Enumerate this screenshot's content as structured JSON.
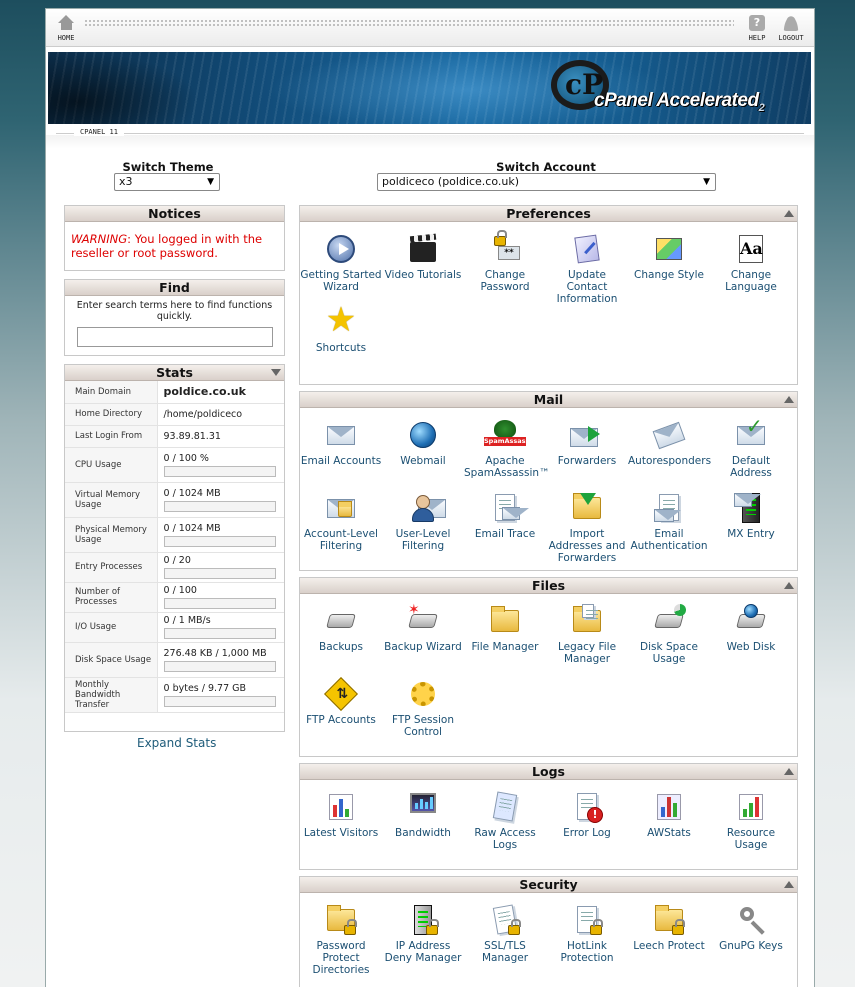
{
  "topbar": {
    "home": "HOME",
    "help": "HELP",
    "logout": "LOGOUT",
    "help_glyph": "?"
  },
  "banner": {
    "logo_mark": "cP",
    "logo_text": "cPanel Accelerated",
    "logo_sub": "2"
  },
  "subbar": {
    "label": "CPANEL 11"
  },
  "switch_theme": {
    "label": "Switch Theme",
    "value": "x3"
  },
  "switch_account": {
    "label": "Switch Account",
    "value": "poldiceco (poldice.co.uk)"
  },
  "notices": {
    "title": "Notices",
    "warning_prefix": "WARNING",
    "warning_text": ": You logged in with the reseller or root password."
  },
  "find": {
    "title": "Find",
    "hint": "Enter search terms here to find functions quickly.",
    "value": ""
  },
  "stats": {
    "title": "Stats",
    "rows": [
      {
        "label": "Main Domain",
        "value": "poldice.co.uk",
        "bold": true
      },
      {
        "label": "Home Directory",
        "value": "/home/poldiceco"
      },
      {
        "label": "Last Login From",
        "value": "93.89.81.31"
      },
      {
        "label": "CPU Usage",
        "value": "0 / 100 %",
        "bar": 0
      },
      {
        "label": "Virtual Memory Usage",
        "value": "0 / 1024 MB",
        "bar": 0
      },
      {
        "label": "Physical Memory Usage",
        "value": "0 / 1024 MB",
        "bar": 0
      },
      {
        "label": "Entry Processes",
        "value": "0 / 20",
        "bar": 0
      },
      {
        "label": "Number of Processes",
        "value": "0 / 100",
        "bar": 0
      },
      {
        "label": "I/O Usage",
        "value": "0 / 1 MB/s",
        "bar": 0
      },
      {
        "label": "Disk Space Usage",
        "value": "276.48 KB / 1,000 MB",
        "bar": 0
      },
      {
        "label": "Monthly Bandwidth Transfer",
        "value": "0 bytes / 9.77 GB",
        "bar": 0
      }
    ],
    "expand": "Expand Stats"
  },
  "sections": {
    "preferences": {
      "title": "Preferences",
      "items": [
        {
          "label": "Getting Started Wizard",
          "icon": "getting-started-wizard-icon"
        },
        {
          "label": "Video Tutorials",
          "icon": "video-tutorials-icon"
        },
        {
          "label": "Change Password",
          "icon": "change-password-icon",
          "glyph": "**"
        },
        {
          "label": "Update Contact Information",
          "icon": "update-contact-icon"
        },
        {
          "label": "Change Style",
          "icon": "change-style-icon"
        },
        {
          "label": "Change Language",
          "icon": "change-language-icon",
          "glyph": "Aa"
        },
        {
          "label": "Shortcuts",
          "icon": "shortcuts-star-icon",
          "glyph": "★"
        }
      ]
    },
    "mail": {
      "title": "Mail",
      "items": [
        {
          "label": "Email Accounts",
          "icon": "email-accounts-icon"
        },
        {
          "label": "Webmail",
          "icon": "webmail-icon"
        },
        {
          "label": "Apache SpamAssassin™",
          "icon": "spamassassin-icon",
          "glyph": "SpamAssassin"
        },
        {
          "label": "Forwarders",
          "icon": "forwarders-icon"
        },
        {
          "label": "Autoresponders",
          "icon": "autoresponders-icon"
        },
        {
          "label": "Default Address",
          "icon": "default-address-icon",
          "glyph": "✓"
        },
        {
          "label": "Account-Level Filtering",
          "icon": "account-level-filtering-icon"
        },
        {
          "label": "User-Level Filtering",
          "icon": "user-level-filtering-icon"
        },
        {
          "label": "Email Trace",
          "icon": "email-trace-icon"
        },
        {
          "label": "Import Addresses and Forwarders",
          "icon": "import-addresses-icon"
        },
        {
          "label": "Email Authentication",
          "icon": "email-authentication-icon"
        },
        {
          "label": "MX Entry",
          "icon": "mx-entry-icon"
        }
      ]
    },
    "files": {
      "title": "Files",
      "items": [
        {
          "label": "Backups",
          "icon": "backups-icon"
        },
        {
          "label": "Backup Wizard",
          "icon": "backup-wizard-icon"
        },
        {
          "label": "File Manager",
          "icon": "file-manager-icon"
        },
        {
          "label": "Legacy File Manager",
          "icon": "legacy-file-manager-icon"
        },
        {
          "label": "Disk Space Usage",
          "icon": "disk-space-usage-icon"
        },
        {
          "label": "Web Disk",
          "icon": "web-disk-icon"
        },
        {
          "label": "FTP Accounts",
          "icon": "ftp-accounts-icon",
          "glyph": "⇅"
        },
        {
          "label": "FTP Session Control",
          "icon": "ftp-session-control-icon"
        }
      ]
    },
    "logs": {
      "title": "Logs",
      "items": [
        {
          "label": "Latest Visitors",
          "icon": "latest-visitors-icon"
        },
        {
          "label": "Bandwidth",
          "icon": "bandwidth-icon"
        },
        {
          "label": "Raw Access Logs",
          "icon": "raw-access-logs-icon"
        },
        {
          "label": "Error Log",
          "icon": "error-log-icon",
          "glyph": "!"
        },
        {
          "label": "AWStats",
          "icon": "awstats-icon"
        },
        {
          "label": "Resource Usage",
          "icon": "resource-usage-icon"
        }
      ]
    },
    "security": {
      "title": "Security",
      "items": [
        {
          "label": "Password Protect Directories",
          "icon": "password-protect-icon"
        },
        {
          "label": "IP Address Deny Manager",
          "icon": "ip-deny-manager-icon"
        },
        {
          "label": "SSL/TLS Manager",
          "icon": "ssl-tls-manager-icon"
        },
        {
          "label": "HotLink Protection",
          "icon": "hotlink-protection-icon"
        },
        {
          "label": "Leech Protect",
          "icon": "leech-protect-icon"
        },
        {
          "label": "GnuPG Keys",
          "icon": "gnupg-keys-icon"
        }
      ]
    }
  }
}
